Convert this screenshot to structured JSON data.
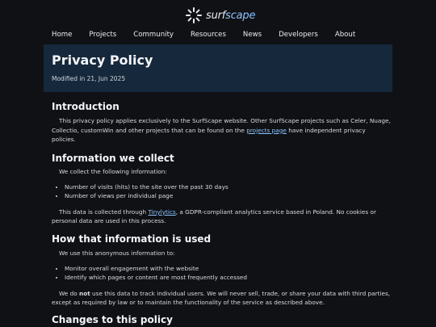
{
  "brand": {
    "part1": "surf",
    "part2": "scape"
  },
  "nav": [
    "Home",
    "Projects",
    "Community",
    "Resources",
    "News",
    "Developers",
    "About"
  ],
  "hero": {
    "title": "Privacy Policy",
    "modified": "Modified in 21, Jun 2025"
  },
  "intro": {
    "heading": "Introduction",
    "text_before": "This privacy policy applies exclusively to the SurfScape website. Other SurfScape projects such as Celer, Nuage, Collectio, customWin and other projects that can be found on the ",
    "link": "projects page",
    "text_after": " have independent privacy policies."
  },
  "collect": {
    "heading": "Information we collect",
    "lead": "We collect the following information:",
    "items": [
      "Number of visits (hits) to the site over the past 30 days",
      "Number of views per individual page"
    ],
    "text_before": "This data is collected through ",
    "link": "Tinylytics",
    "text_after": ", a GDPR-compliant analytics service based in Poland. No cookies or personal data are used in this process."
  },
  "usage": {
    "heading": "How that information is used",
    "lead": "We use this anonymous information to:",
    "items": [
      "Monitor overall engagement with the website",
      "Identify which pages or content are most frequently accessed"
    ],
    "text_before": "We do ",
    "bold": "not",
    "text_after": " use this data to track individual users. We will never sell, trade, or share your data with third parties, except as required by law or to maintain the functionality of the service as described above."
  },
  "changes": {
    "heading": "Changes to this policy"
  }
}
